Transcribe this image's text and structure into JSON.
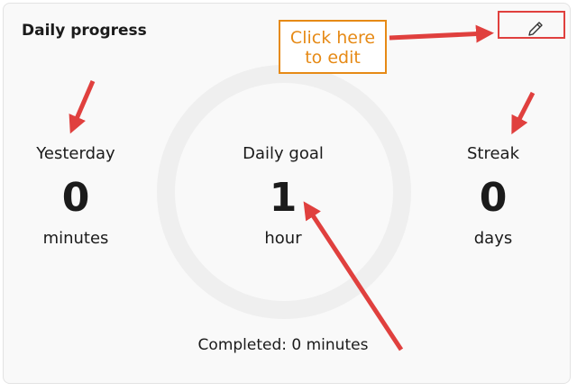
{
  "card": {
    "title": "Daily progress",
    "edit_icon": "pencil-icon"
  },
  "stats": {
    "yesterday": {
      "label": "Yesterday",
      "value": "0",
      "unit": "minutes"
    },
    "goal": {
      "label": "Daily goal",
      "value": "1",
      "unit": "hour"
    },
    "streak": {
      "label": "Streak",
      "value": "0",
      "unit": "days"
    }
  },
  "completed": "Completed: 0 minutes",
  "callout": {
    "line1": "Click here",
    "line2": "to edit"
  },
  "colors": {
    "ring": "#efefef",
    "callout_text": "#e68a16",
    "arrow": "#e0403e"
  }
}
